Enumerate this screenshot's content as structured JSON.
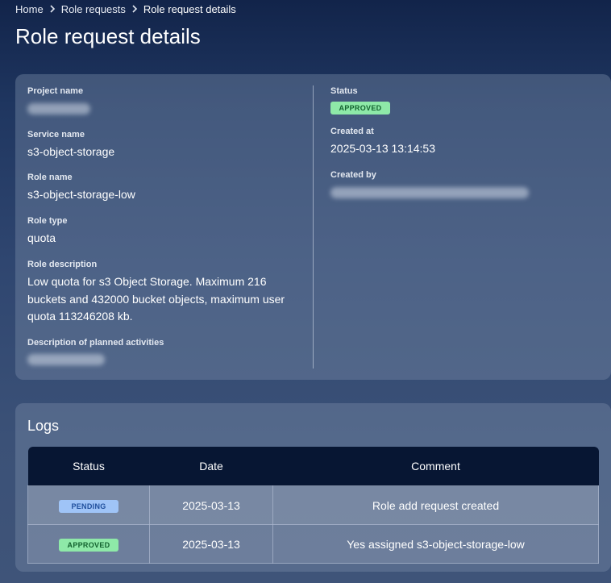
{
  "breadcrumb": {
    "items": [
      {
        "label": "Home"
      },
      {
        "label": "Role requests"
      },
      {
        "label": "Role request details"
      }
    ]
  },
  "page": {
    "title": "Role request details"
  },
  "details": {
    "project_name_label": "Project name",
    "service_name_label": "Service name",
    "service_name": "s3-object-storage",
    "role_name_label": "Role name",
    "role_name": "s3-object-storage-low",
    "role_type_label": "Role type",
    "role_type": "quota",
    "role_description_label": "Role description",
    "role_description": "Low quota for s3 Object Storage. Maximum 216 buckets and 432000 bucket objects, maximum user quota 113246208 kb.",
    "planned_activities_label": "Description of planned activities",
    "status_label": "Status",
    "status": "APPROVED",
    "created_at_label": "Created at",
    "created_at": "2025-03-13 13:14:53",
    "created_by_label": "Created by"
  },
  "logs": {
    "title": "Logs",
    "columns": [
      "Status",
      "Date",
      "Comment"
    ],
    "rows": [
      {
        "status": "PENDING",
        "date": "2025-03-13",
        "comment": "Role add request created"
      },
      {
        "status": "APPROVED",
        "date": "2025-03-13",
        "comment": "Yes assigned s3-object-storage-low"
      }
    ]
  },
  "colors": {
    "approved_bg": "#8ee9a8",
    "approved_text": "#13622f",
    "pending_bg": "#9fc4f7",
    "pending_text": "#1f4f9c",
    "table_header_bg": "#071633"
  }
}
